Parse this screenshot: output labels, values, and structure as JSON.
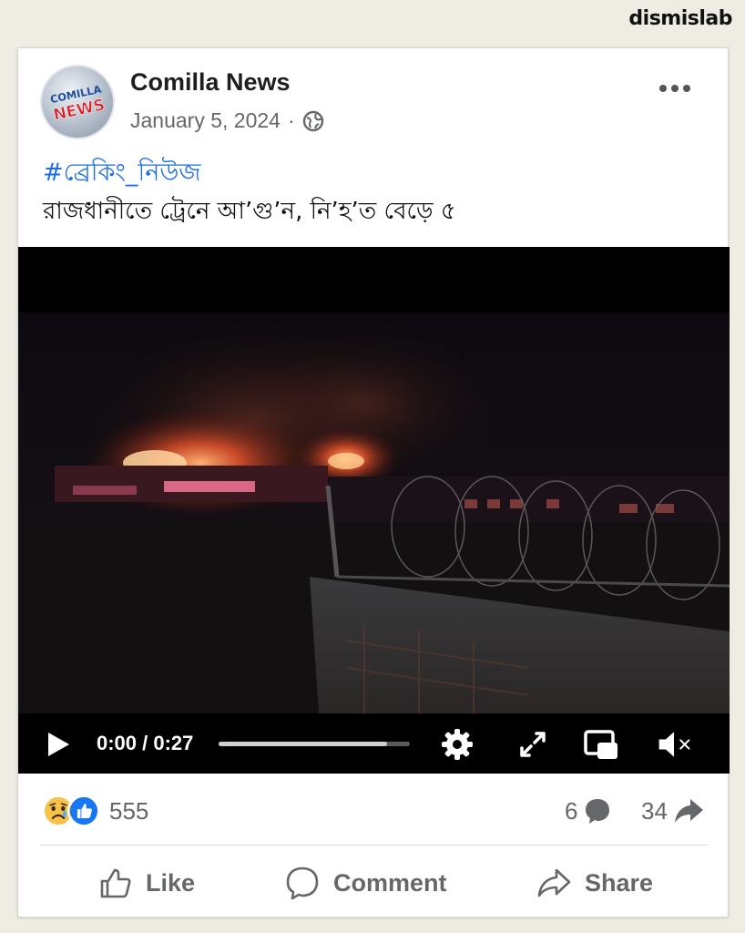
{
  "watermark": "dismislab",
  "post": {
    "page_name": "Comilla News",
    "date": "January 5, 2024",
    "separator": "·",
    "hashtag": "#ব্রেকিং_নিউজ",
    "headline": "রাজধানীতে ট্রেনে আ’গু’ন, নি’হ’ত বেড়ে ৫",
    "avatar_text": [
      "COMILLA",
      "NEWS"
    ]
  },
  "video": {
    "current_time": "0:00",
    "duration": "0:27",
    "time_display": "0:00 / 0:27",
    "progress": 0.88,
    "icons": [
      "play-icon",
      "settings-icon",
      "fullscreen-icon",
      "picture-in-picture-icon",
      "volume-muted-icon"
    ]
  },
  "stats": {
    "reaction_count": "555",
    "comment_count": "6",
    "share_count": "34",
    "reaction_icons": [
      "sad-reaction-icon",
      "like-reaction-icon"
    ]
  },
  "actions": {
    "like_label": "Like",
    "comment_label": "Comment",
    "share_label": "Share"
  },
  "colors": {
    "link_blue": "#1f6fe0",
    "like_blue": "#1877f2",
    "muted_text": "#65676b",
    "background": "#efece4"
  }
}
